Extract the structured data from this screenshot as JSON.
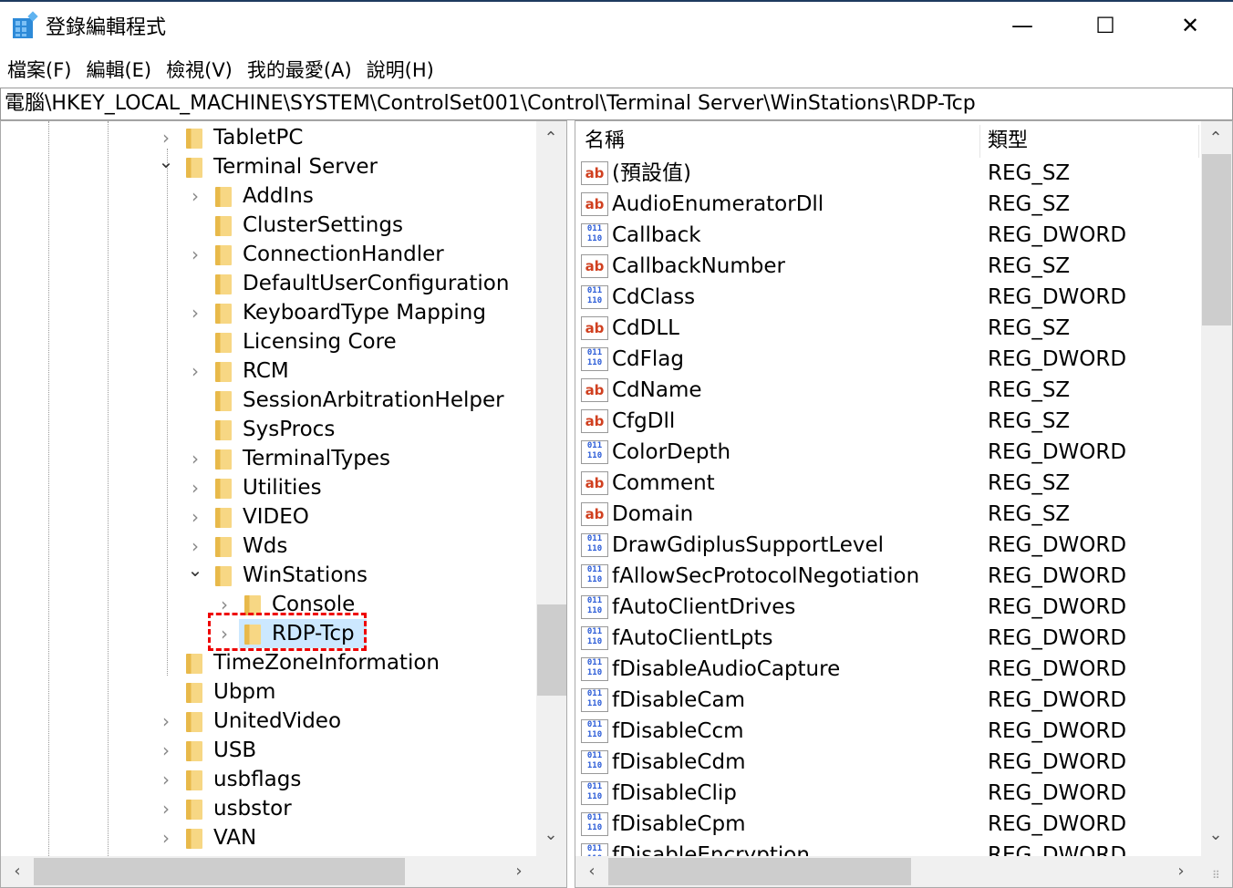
{
  "window": {
    "title": "登錄編輯程式",
    "minimize": "—",
    "maximize": "☐",
    "close": "✕"
  },
  "menu": [
    "檔案(F)",
    "編輯(E)",
    "檢視(V)",
    "我的最愛(A)",
    "說明(H)"
  ],
  "address": "電腦\\HKEY_LOCAL_MACHINE\\SYSTEM\\ControlSet001\\Control\\Terminal Server\\WinStations\\RDP-Tcp",
  "tree": [
    {
      "label": "TabletPC",
      "level": 0,
      "exp": "closed"
    },
    {
      "label": "Terminal Server",
      "level": 0,
      "exp": "open"
    },
    {
      "label": "AddIns",
      "level": 1,
      "exp": "closed"
    },
    {
      "label": "ClusterSettings",
      "level": 1,
      "exp": "none"
    },
    {
      "label": "ConnectionHandler",
      "level": 1,
      "exp": "closed"
    },
    {
      "label": "DefaultUserConfiguration",
      "level": 1,
      "exp": "none"
    },
    {
      "label": "KeyboardType Mapping",
      "level": 1,
      "exp": "closed"
    },
    {
      "label": "Licensing Core",
      "level": 1,
      "exp": "none"
    },
    {
      "label": "RCM",
      "level": 1,
      "exp": "closed"
    },
    {
      "label": "SessionArbitrationHelper",
      "level": 1,
      "exp": "none"
    },
    {
      "label": "SysProcs",
      "level": 1,
      "exp": "none"
    },
    {
      "label": "TerminalTypes",
      "level": 1,
      "exp": "closed"
    },
    {
      "label": "Utilities",
      "level": 1,
      "exp": "closed"
    },
    {
      "label": "VIDEO",
      "level": 1,
      "exp": "closed"
    },
    {
      "label": "Wds",
      "level": 1,
      "exp": "closed"
    },
    {
      "label": "WinStations",
      "level": 1,
      "exp": "open"
    },
    {
      "label": "Console",
      "level": 2,
      "exp": "closed"
    },
    {
      "label": "RDP-Tcp",
      "level": 2,
      "exp": "closed",
      "selected": true
    },
    {
      "label": "TimeZoneInformation",
      "level": 0,
      "exp": "none"
    },
    {
      "label": "Ubpm",
      "level": 0,
      "exp": "none"
    },
    {
      "label": "UnitedVideo",
      "level": 0,
      "exp": "closed"
    },
    {
      "label": "USB",
      "level": 0,
      "exp": "closed"
    },
    {
      "label": "usbflags",
      "level": 0,
      "exp": "closed"
    },
    {
      "label": "usbstor",
      "level": 0,
      "exp": "closed"
    },
    {
      "label": "VAN",
      "level": 0,
      "exp": "closed"
    }
  ],
  "columns": {
    "name": "名稱",
    "type": "類型"
  },
  "values": [
    {
      "name": "(預設值)",
      "type": "REG_SZ"
    },
    {
      "name": "AudioEnumeratorDll",
      "type": "REG_SZ"
    },
    {
      "name": "Callback",
      "type": "REG_DWORD"
    },
    {
      "name": "CallbackNumber",
      "type": "REG_SZ"
    },
    {
      "name": "CdClass",
      "type": "REG_DWORD"
    },
    {
      "name": "CdDLL",
      "type": "REG_SZ"
    },
    {
      "name": "CdFlag",
      "type": "REG_DWORD"
    },
    {
      "name": "CdName",
      "type": "REG_SZ"
    },
    {
      "name": "CfgDll",
      "type": "REG_SZ"
    },
    {
      "name": "ColorDepth",
      "type": "REG_DWORD"
    },
    {
      "name": "Comment",
      "type": "REG_SZ"
    },
    {
      "name": "Domain",
      "type": "REG_SZ"
    },
    {
      "name": "DrawGdiplusSupportLevel",
      "type": "REG_DWORD"
    },
    {
      "name": "fAllowSecProtocolNegotiation",
      "type": "REG_DWORD"
    },
    {
      "name": "fAutoClientDrives",
      "type": "REG_DWORD"
    },
    {
      "name": "fAutoClientLpts",
      "type": "REG_DWORD"
    },
    {
      "name": "fDisableAudioCapture",
      "type": "REG_DWORD"
    },
    {
      "name": "fDisableCam",
      "type": "REG_DWORD"
    },
    {
      "name": "fDisableCcm",
      "type": "REG_DWORD"
    },
    {
      "name": "fDisableCdm",
      "type": "REG_DWORD"
    },
    {
      "name": "fDisableClip",
      "type": "REG_DWORD"
    },
    {
      "name": "fDisableCpm",
      "type": "REG_DWORD"
    },
    {
      "name": "fDisableEncryption",
      "type": "REG_DWORD"
    }
  ],
  "icons": {
    "sz": "ab",
    "dword": "011\n110"
  },
  "colors": {
    "selection": "#cce8ff",
    "highlight_box": "#ee0000",
    "folder": "#f7d784"
  }
}
